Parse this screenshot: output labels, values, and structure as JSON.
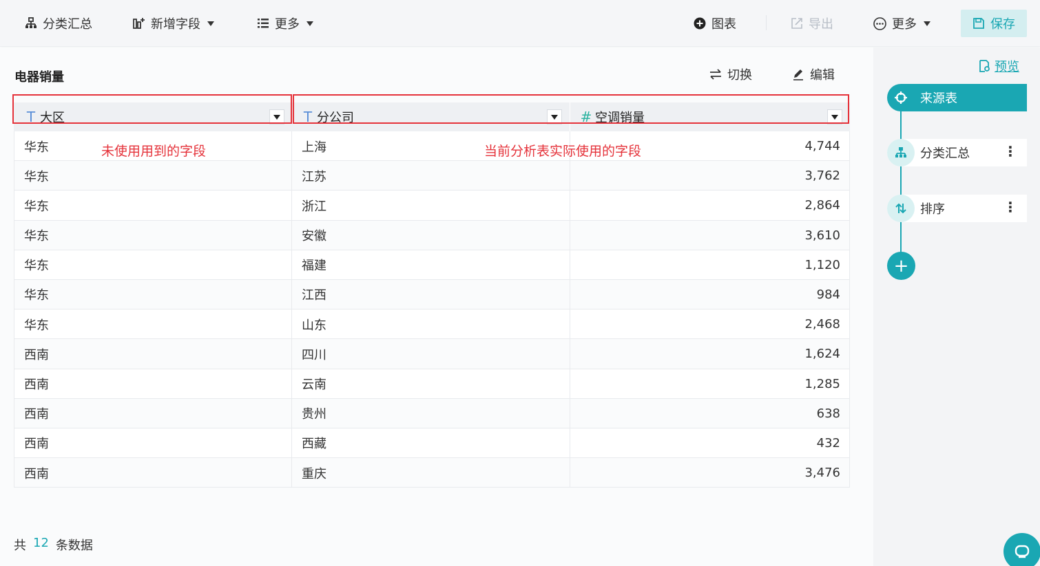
{
  "toolbar": {
    "group_summary": "分类汇总",
    "add_field": "新增字段",
    "more_left": "更多",
    "chart": "图表",
    "export": "导出",
    "more_right": "更多",
    "save": "保存"
  },
  "main": {
    "title": "电器销量",
    "switch": "切换",
    "edit": "编辑",
    "columns": [
      {
        "type_icon": "T",
        "label": "大区"
      },
      {
        "type_icon": "T",
        "label": "分公司"
      },
      {
        "type_icon": "#",
        "label": "空调销量"
      }
    ],
    "rows": [
      [
        "华东",
        "上海",
        "4,744"
      ],
      [
        "华东",
        "江苏",
        "3,762"
      ],
      [
        "华东",
        "浙江",
        "2,864"
      ],
      [
        "华东",
        "安徽",
        "3,610"
      ],
      [
        "华东",
        "福建",
        "1,120"
      ],
      [
        "华东",
        "江西",
        "984"
      ],
      [
        "华东",
        "山东",
        "2,468"
      ],
      [
        "西南",
        "四川",
        "1,624"
      ],
      [
        "西南",
        "云南",
        "1,285"
      ],
      [
        "西南",
        "贵州",
        "638"
      ],
      [
        "西南",
        "西藏",
        "432"
      ],
      [
        "西南",
        "重庆",
        "3,476"
      ]
    ],
    "annotation_unused": "未使用用到的字段",
    "annotation_used": "当前分析表实际使用的字段",
    "footer": {
      "prefix": "共",
      "count": "12",
      "suffix": "条数据"
    }
  },
  "side": {
    "preview": "预览",
    "steps": [
      {
        "label": "来源表",
        "icon": "source-icon"
      },
      {
        "label": "分类汇总",
        "icon": "group-summary-icon"
      },
      {
        "label": "排序",
        "icon": "sort-icon"
      }
    ],
    "add": "+"
  },
  "colors": {
    "accent": "#1aa7b3",
    "annotation": "#e5323a"
  }
}
